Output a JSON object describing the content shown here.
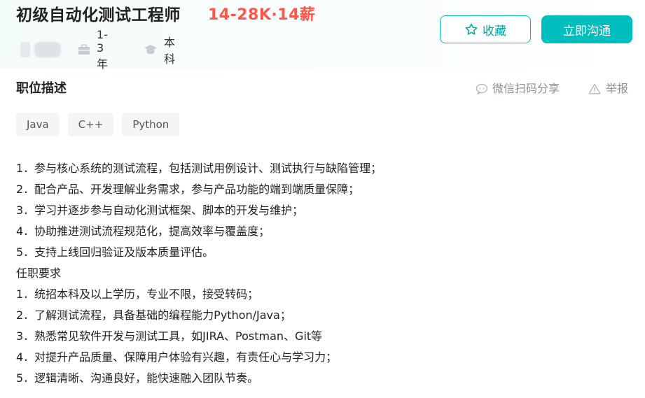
{
  "job": {
    "title": "初级自动化测试工程师",
    "salary": "14-28K·14薪",
    "experience": "1-3年",
    "education": "本科"
  },
  "actions": {
    "collect_label": "收藏",
    "chat_label": "立即沟通"
  },
  "section": {
    "title": "职位描述",
    "share_label": "微信扫码分享",
    "report_label": "举报"
  },
  "tags": [
    "Java",
    "C++",
    "Python"
  ],
  "description": {
    "lines": [
      "1．参与核心系统的测试流程，包括测试用例设计、测试执行与缺陷管理；",
      "2．配合产品、开发理解业务需求，参与产品功能的端到端质量保障；",
      "3．学习并逐步参与自动化测试框架、脚本的开发与维护；",
      "4．协助推进测试流程规范化，提高效率与覆盖度；",
      "5．支持上线回归验证及版本质量评估。",
      "任职要求",
      "1．统招本科及以上学历，专业不限，接受转码；",
      "2．了解测试流程，具备基础的编程能力Python/Java；",
      "3．熟悉常见软件开发与测试工具，如JIRA、Postman、Git等",
      "4．对提升产品质量、保障用户体验有兴趣，有责任心与学习力；",
      "5．逻辑清晰、沟通良好，能快速融入团队节奏。"
    ]
  },
  "colors": {
    "accent": "#00bebd",
    "salary": "#fe574a",
    "muted": "#8d9299"
  },
  "icons": {
    "collect": "star-icon",
    "experience": "briefcase-icon",
    "education": "graduation-cap-icon",
    "share": "wechat-icon",
    "report": "warning-icon"
  }
}
